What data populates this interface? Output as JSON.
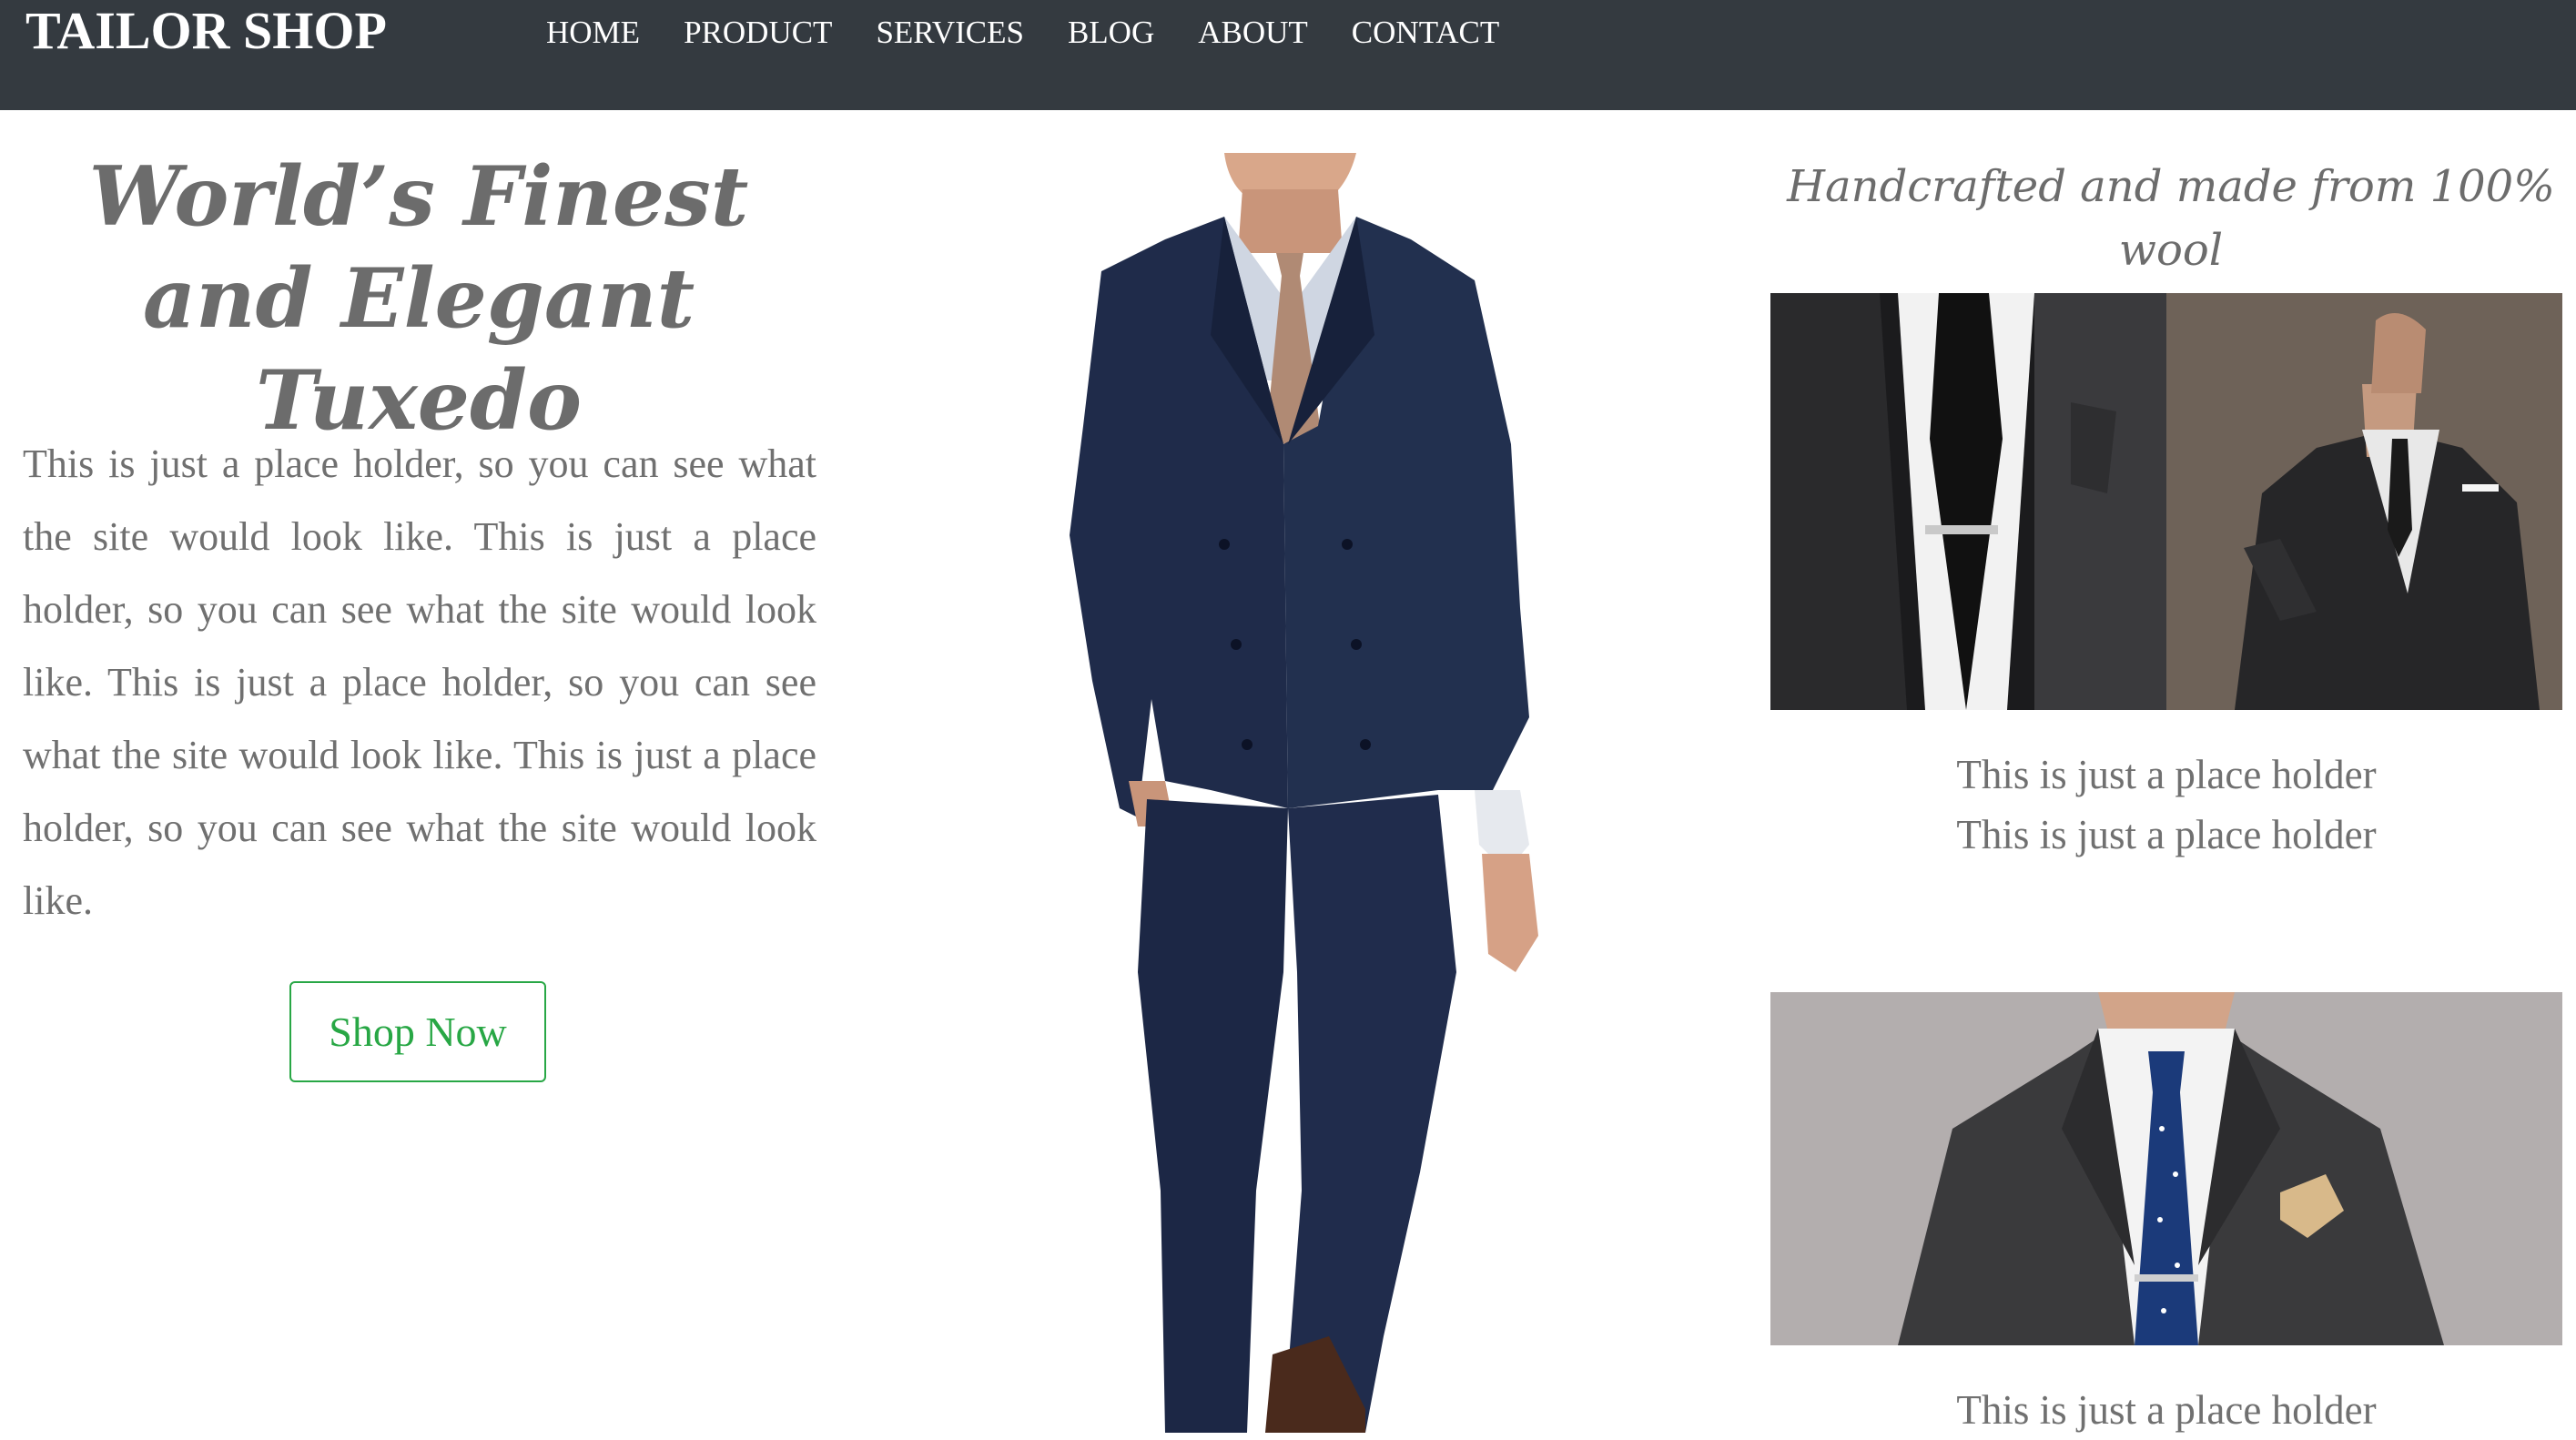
{
  "navbar": {
    "brand": "TAILOR SHOP",
    "links": [
      "HOME",
      "PRODUCT",
      "SERVICES",
      "BLOG",
      "ABOUT",
      "CONTACT"
    ],
    "background": "#343a40"
  },
  "hero": {
    "title": "World’s Finest and Elegant Tuxedo",
    "text": "This is just a place holder, so you can see what the site would look like. This is just a place holder, so you can see what the site would look like. This is just a place holder, so you can see what the site would look like. This is just a place holder, so you can see what the site would look like.",
    "button_label": "Shop Now",
    "button_color": "#28a745"
  },
  "side": {
    "title": "Handcrafted and made from 100% wool",
    "captions": [
      "This is just a place holder",
      "This is just a place holder",
      "This is just a place holder"
    ]
  }
}
